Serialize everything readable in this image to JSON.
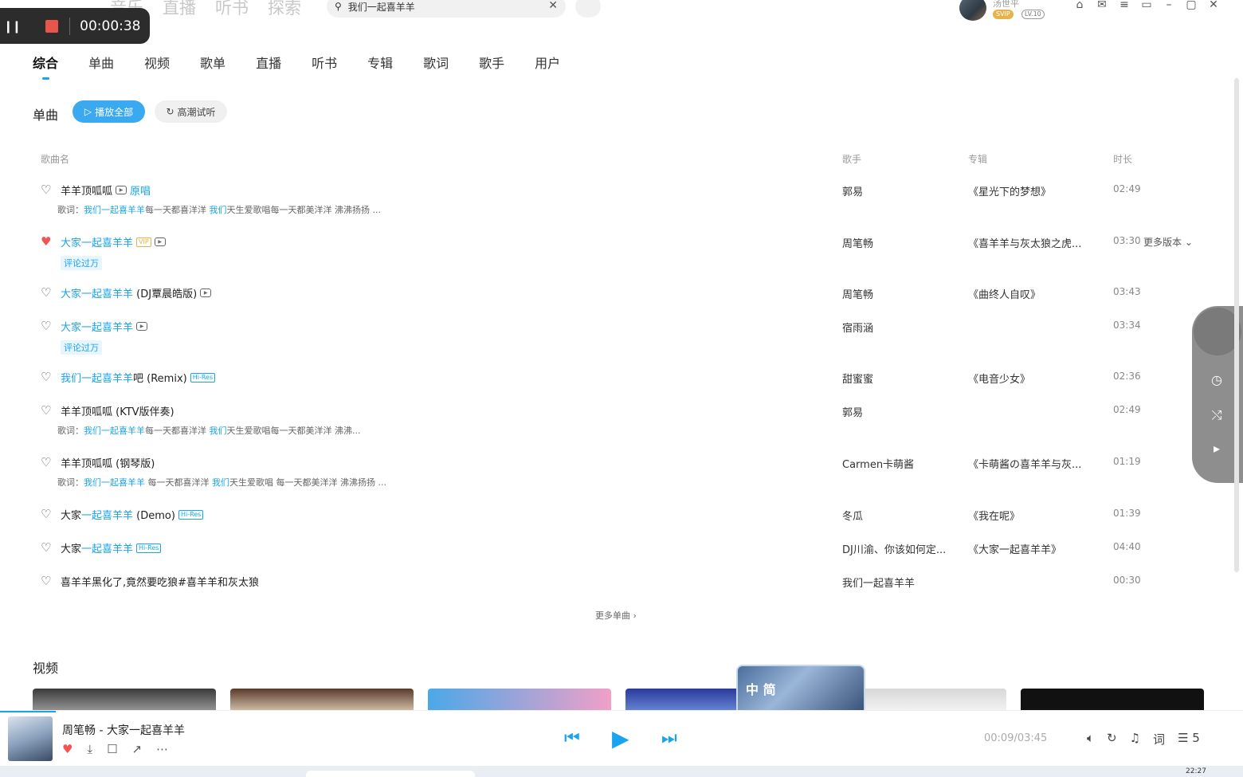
{
  "topnav": [
    "音乐",
    "直播",
    "听书",
    "探索"
  ],
  "search": {
    "query": "我们一起喜羊羊"
  },
  "user": {
    "name": "汤世平",
    "svip": "SVIP",
    "level": "LV.10"
  },
  "recording": {
    "time": "00:00:38"
  },
  "tabs": [
    "综合",
    "单曲",
    "视频",
    "歌单",
    "直播",
    "听书",
    "专辑",
    "歌词",
    "歌手",
    "用户"
  ],
  "songs_section": {
    "title": "单曲",
    "play_all": "播放全部",
    "highlight": "高潮试听"
  },
  "columns": {
    "name": "歌曲名",
    "artist": "歌手",
    "album": "专辑",
    "duration": "时长"
  },
  "songs": [
    {
      "pre": "",
      "hl": "",
      "post": "羊羊顶呱呱",
      "tags": [
        "mv"
      ],
      "extra": "原唱",
      "lyric_label": "歌词：",
      "lyric_hl1": "我们一起喜羊羊",
      "lyric_mid": "每一天都喜洋洋 ",
      "lyric_hl2": "我们",
      "lyric_rest": "天生爱歌唱每一天都美洋洋 沸沸扬扬 ...",
      "artist": "郭易",
      "album": "《星光下的梦想》",
      "duration": "02:49",
      "liked": false
    },
    {
      "pre": "",
      "hl": "大家一起喜羊羊",
      "post": "",
      "tags": [
        "vip",
        "mv"
      ],
      "hot": "评论过万",
      "artist": "周笔畅",
      "album": "《喜羊羊与灰太狼之虎...",
      "duration": "03:30",
      "more": "更多版本",
      "liked": true
    },
    {
      "pre": "",
      "hl": "大家一起喜羊羊",
      "post": " (DJ覃晨皓版)",
      "tags": [
        "mv"
      ],
      "artist": "周笔畅",
      "album": "《曲终人自叹》",
      "duration": "03:43",
      "liked": false
    },
    {
      "pre": "",
      "hl": "大家一起喜羊羊",
      "post": "",
      "tags": [
        "mv"
      ],
      "hot": "评论过万",
      "artist": "宿雨涵",
      "album": "",
      "duration": "03:34",
      "liked": false
    },
    {
      "pre": "",
      "hl": "我们一起喜羊羊",
      "post": "吧 (Remix)",
      "tags": [
        "hires"
      ],
      "artist": "甜蜜蜜",
      "album": "《电音少女》",
      "duration": "02:36",
      "liked": false
    },
    {
      "pre": "",
      "hl": "",
      "post": "羊羊顶呱呱 (KTV版伴奏)",
      "tags": [],
      "lyric_label": "歌词：",
      "lyric_hl1": "我们一起喜羊羊",
      "lyric_mid": "每一天都喜洋洋 ",
      "lyric_hl2": "我们",
      "lyric_rest": "天生爱歌唱每一天都美洋洋        沸沸...",
      "artist": "郭易",
      "album": "",
      "duration": "02:49",
      "liked": false
    },
    {
      "pre": "",
      "hl": "",
      "post": "羊羊顶呱呱 (钢琴版)",
      "tags": [],
      "lyric_label": "歌词：",
      "lyric_hl1": "我们一起喜羊羊",
      "lyric_mid": " 每一天都喜洋洋 ",
      "lyric_hl2": "我们",
      "lyric_rest": "天生爱歌唱 每一天都美洋洋 沸沸扬扬 ...",
      "artist": "Carmen卡萌酱",
      "album": "《卡萌酱の喜羊羊与灰...",
      "duration": "01:19",
      "liked": false
    },
    {
      "pre": "大家",
      "hl": "一起喜羊羊",
      "post": " (Demo)",
      "tags": [
        "hires"
      ],
      "artist": "冬瓜",
      "album": "《我在呢》",
      "duration": "01:39",
      "liked": false
    },
    {
      "pre": "大家",
      "hl": "一起喜羊羊",
      "post": "",
      "tags": [
        "hires"
      ],
      "artist": "DJ川渝、你该如何定...",
      "album": "《大家一起喜羊羊》",
      "duration": "04:40",
      "liked": false
    },
    {
      "pre": "",
      "hl": "",
      "post": "喜羊羊黑化了,竟然要吃狼#喜羊羊和灰太狼",
      "tags": [],
      "artist": "我们一起喜羊羊",
      "artist_hl": true,
      "album": "",
      "duration": "00:30",
      "liked": false
    }
  ],
  "more_songs": "更多单曲",
  "video_section": {
    "title": "视频"
  },
  "badge_text": "中 简",
  "player": {
    "title": "周笔畅 - 大家一起喜羊羊",
    "time": "00:09/03:45",
    "lyrics_btn": "词",
    "playlist_count": "5"
  },
  "taskbar": {
    "time": "22:27"
  },
  "tags_text": {
    "vip": "VIP",
    "hires": "Hi-Res",
    "mv": "▶"
  }
}
